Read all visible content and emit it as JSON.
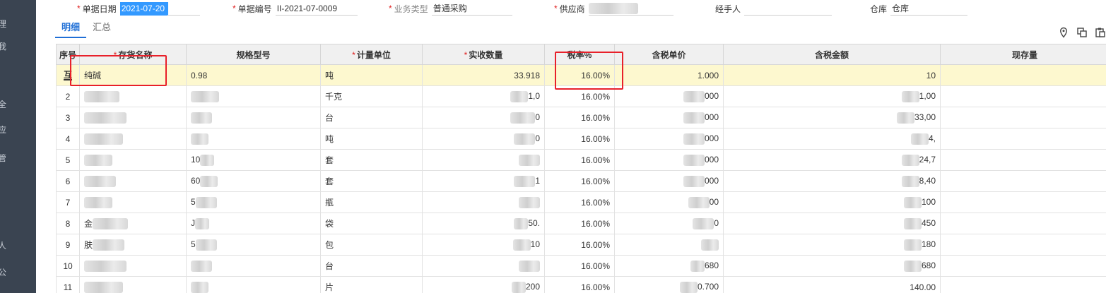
{
  "sidebar": {
    "glyphs": [
      "理",
      "我",
      "全",
      "应",
      "管",
      "人",
      "公"
    ]
  },
  "form": {
    "date_label": "单据日期",
    "date_value": "2021-07-20",
    "code_label": "单据编号",
    "code_value": "II-2021-07-0009",
    "biztype_label": "业务类型",
    "biztype_value": "普通采购",
    "supplier_label": "供应商",
    "supplier_value": "",
    "handler_label": "经手人",
    "handler_value": "",
    "warehouse_label": "仓库",
    "warehouse_value": "仓库"
  },
  "tabs": [
    "明细",
    "汇总"
  ],
  "toolbar": {
    "icons": [
      "location-icon",
      "copy-icon",
      "paste-icon"
    ]
  },
  "table": {
    "headers": {
      "idx": "序号",
      "name": "存货名称",
      "spec": "规格型号",
      "unit": "计量单位",
      "qty": "实收数量",
      "tax": "税率%",
      "price": "含税单价",
      "amount": "含税金额",
      "stock": "现存量"
    },
    "rows": [
      {
        "idx": "互",
        "name": "纯碱",
        "spec": "0.98",
        "unit": "吨",
        "qty": "33.918",
        "tax": "16.00%",
        "price": "1.000",
        "amount": "10",
        "stock": ""
      },
      {
        "idx": "2",
        "name": "",
        "spec": "",
        "unit": "千克",
        "qty": "1,0",
        "tax": "16.00%",
        "price": "000",
        "amount": "1,00",
        "stock": ""
      },
      {
        "idx": "3",
        "name": "",
        "spec": "",
        "unit": "台",
        "qty": "0",
        "tax": "16.00%",
        "price": "000",
        "amount": "33,00",
        "stock": ""
      },
      {
        "idx": "4",
        "name": "",
        "spec": "",
        "unit": "吨",
        "qty": "0",
        "tax": "16.00%",
        "price": "000",
        "amount": "4,",
        "stock": ""
      },
      {
        "idx": "5",
        "name": "",
        "spec": "10",
        "unit": "套",
        "qty": "",
        "tax": "16.00%",
        "price": "000",
        "amount": "24,7",
        "stock": ""
      },
      {
        "idx": "6",
        "name": "",
        "spec": "60",
        "unit": "套",
        "qty": "1",
        "tax": "16.00%",
        "price": "000",
        "amount": "8,40",
        "stock": ""
      },
      {
        "idx": "7",
        "name": "",
        "spec": "5",
        "unit": "瓶",
        "qty": "",
        "tax": "16.00%",
        "price": "00",
        "amount": "100",
        "stock": ""
      },
      {
        "idx": "8",
        "name": "金",
        "spec": "J",
        "unit": "袋",
        "qty": "50.",
        "tax": "16.00%",
        "price": "0",
        "amount": "450",
        "stock": ""
      },
      {
        "idx": "9",
        "name": "肤",
        "spec": "5",
        "unit": "包",
        "qty": "10",
        "tax": "16.00%",
        "price": "",
        "amount": "180",
        "stock": ""
      },
      {
        "idx": "10",
        "name": "",
        "spec": "",
        "unit": "台",
        "qty": "",
        "tax": "16.00%",
        "price": "680",
        "amount": "680",
        "stock": ""
      },
      {
        "idx": "11",
        "name": "",
        "spec": "",
        "unit": "片",
        "qty": "200",
        "tax": "16.00%",
        "price": "0.700",
        "amount": "140.00",
        "stock": ""
      }
    ]
  }
}
